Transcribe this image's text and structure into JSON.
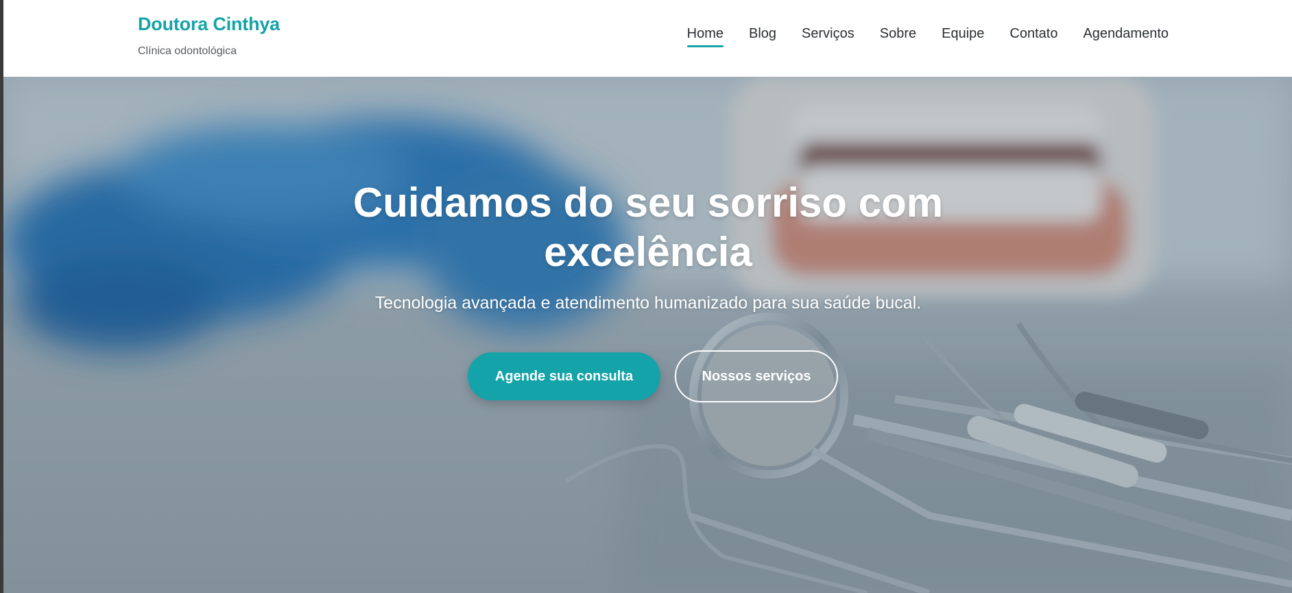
{
  "brand": {
    "name": "Doutora Cinthya",
    "tagline": "Clínica odontológica",
    "accent_color": "#13a3a8"
  },
  "nav": {
    "items": [
      {
        "label": "Home",
        "active": true
      },
      {
        "label": "Blog",
        "active": false
      },
      {
        "label": "Serviços",
        "active": false
      },
      {
        "label": "Sobre",
        "active": false
      },
      {
        "label": "Equipe",
        "active": false
      },
      {
        "label": "Contato",
        "active": false
      },
      {
        "label": "Agendamento",
        "active": false
      }
    ]
  },
  "hero": {
    "title": "Cuidamos do seu sorriso com excelência",
    "subtitle": "Tecnologia avançada e atendimento humanizado para sua saúde bucal.",
    "primary_button": "Agende sua consulta",
    "secondary_button": "Nossos serviços",
    "background_image": "dental-instruments-photo"
  }
}
